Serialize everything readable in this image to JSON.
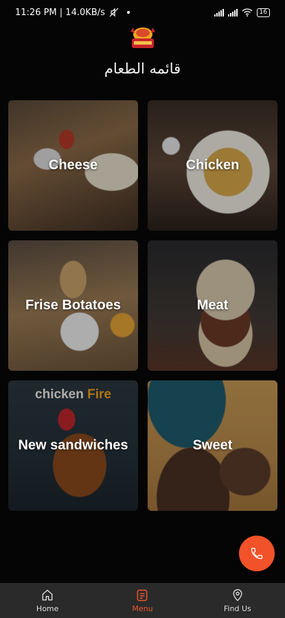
{
  "status_bar": {
    "time_speed": "11:26 PM | 14.0KB/s",
    "battery": "16"
  },
  "header": {
    "title": "قائمه الطعام",
    "logo_icon": "burger-logo-icon"
  },
  "menu": {
    "categories": [
      {
        "label": "Cheese"
      },
      {
        "label": "Chicken"
      },
      {
        "label": "Frise Botatoes"
      },
      {
        "label": "Meat"
      },
      {
        "label": "New sandwiches",
        "banner_word_1": "chicken",
        "banner_word_2": "Fire"
      },
      {
        "label": "Sweet"
      }
    ]
  },
  "fab": {
    "icon": "phone-icon",
    "color": "#f2522a"
  },
  "bottom_nav": {
    "items": [
      {
        "label": "Home",
        "icon": "home-icon"
      },
      {
        "label": "Menu",
        "icon": "menu-icon",
        "active": true
      },
      {
        "label": "Find Us",
        "icon": "location-pin-icon"
      }
    ],
    "active_color": "#f0572a"
  }
}
